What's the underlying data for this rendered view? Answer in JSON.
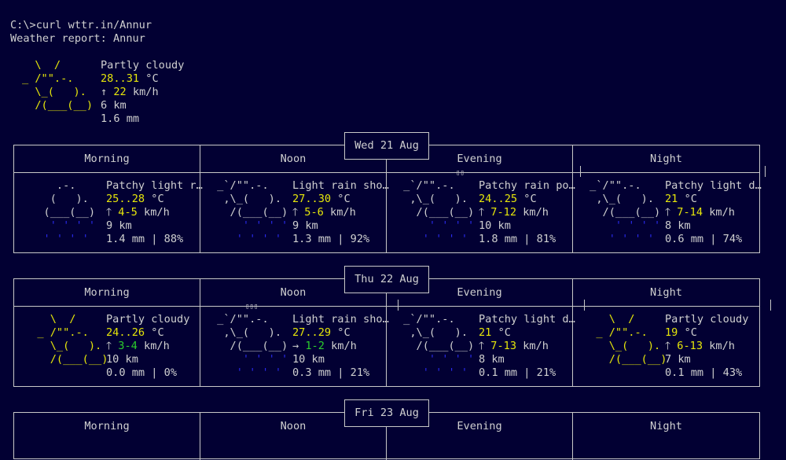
{
  "prompt": "C:\\>curl wttr.in/Annur",
  "report_title": "Weather report: Annur",
  "current": {
    "art": [
      "  \\  /",
      "_ /\"\".-.",
      "  \\_(   ).",
      "  /(___(__)"
    ],
    "condition": "Partly cloudy",
    "temp": "28..31",
    "temp_unit": "°C",
    "wind_arrow": "↑",
    "wind": "22",
    "wind_unit": "km/h",
    "visibility": "6 km",
    "precip": "1.6 mm"
  },
  "periods": [
    "Morning",
    "Noon",
    "Evening",
    "Night"
  ],
  "days": [
    {
      "date": "Wed 21 Aug",
      "cells": [
        {
          "art": [
            "     .-.",
            "    (   ).",
            "   (___(__)",
            "    ' ' ' '",
            "   ' ' ' '"
          ],
          "cond": "Patchy light r…",
          "temp": "25..28",
          "unit": "°C",
          "warrow": "🡑",
          "wind": "4-5",
          "wunit": "km/h",
          "vis": "9 km",
          "precip": "1.4 mm | 88%",
          "windcolor": "#e6e60a"
        },
        {
          "art": [
            " _`/\"\".-.",
            "  ,\\_(   ).",
            "   /(___(__)",
            "     ' ' ' '",
            "    ' ' ' '"
          ],
          "cond": "Light rain sho…",
          "temp": "27..30",
          "unit": "°C",
          "warrow": "🡑",
          "wind": "5-6",
          "wunit": "km/h",
          "vis": "9 km",
          "precip": "1.3 mm | 92%",
          "windcolor": "#e6e60a"
        },
        {
          "art": [
            " _`/\"\".-.",
            "  ,\\_(   ).",
            "   /(___(__)",
            "     ' ' ' '",
            "    ' ' ' '"
          ],
          "cond": "Patchy rain po…",
          "temp": "24..25",
          "unit": "°C",
          "warrow": "🡑",
          "wind": "7-12",
          "wunit": "km/h",
          "vis": "10 km",
          "precip": "1.8 mm | 81%",
          "windcolor": "#e6e60a"
        },
        {
          "art": [
            " _`/\"\".-.",
            "  ,\\_(   ).",
            "   /(___(__)",
            "     ' ' ' '",
            "    ' ' ' '"
          ],
          "cond": "Patchy light d…",
          "temp": "21",
          "unit": "°C",
          "warrow": "🡑",
          "wind": "7-14",
          "wunit": "km/h",
          "vis": "8 km",
          "precip": "0.6 mm | 74%",
          "windcolor": "#e6e60a"
        }
      ]
    },
    {
      "date": "Thu 22 Aug",
      "cells": [
        {
          "art": [
            "    \\  /",
            "  _ /\"\".-.",
            "    \\_(   ).",
            "    /(___(__)"
          ],
          "cond": "Partly cloudy",
          "temp": "24..26",
          "unit": "°C",
          "warrow": "🡑",
          "wind": "3-4",
          "wunit": "km/h",
          "vis": "10 km",
          "precip": "0.0 mm | 0%",
          "windcolor": "#2ccf2c"
        },
        {
          "art": [
            " _`/\"\".-.",
            "  ,\\_(   ).",
            "   /(___(__)",
            "     ' ' ' '",
            "    ' ' ' '"
          ],
          "cond": "Light rain sho…",
          "temp": "27..29",
          "unit": "°C",
          "warrow": "→",
          "wind": "1-2",
          "wunit": "km/h",
          "vis": "10 km",
          "precip": "0.3 mm | 21%",
          "windcolor": "#2ccf2c"
        },
        {
          "art": [
            " _`/\"\".-.",
            "  ,\\_(   ).",
            "   /(___(__)",
            "     ' ' ' '",
            "    ' ' ' '"
          ],
          "cond": "Patchy light d…",
          "temp": "21",
          "unit": "°C",
          "warrow": "🡑",
          "wind": "7-13",
          "wunit": "km/h",
          "vis": "8 km",
          "precip": "0.1 mm | 21%",
          "windcolor": "#e6e60a"
        },
        {
          "art": [
            "    \\  /",
            "  _ /\"\".-.",
            "    \\_(   ).",
            "    /(___(__)"
          ],
          "cond": "Partly cloudy",
          "temp": "19",
          "unit": "°C",
          "warrow": "🡑",
          "wind": "6-13",
          "wunit": "km/h",
          "vis": "7 km",
          "precip": "0.1 mm | 43%",
          "windcolor": "#e6e60a"
        }
      ]
    },
    {
      "date": "Fri 23 Aug",
      "cells": []
    }
  ],
  "colors": {
    "background": "#020033",
    "text": "#cfcfcf",
    "yellow": "#e6e60a",
    "green": "#2ccf2c",
    "blue": "#2a2aee"
  }
}
